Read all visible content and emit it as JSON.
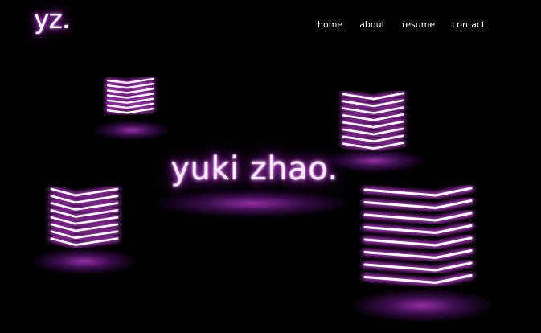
{
  "brand": {
    "logo": "yz."
  },
  "nav": {
    "items": [
      {
        "label": "home"
      },
      {
        "label": "about"
      },
      {
        "label": "resume"
      },
      {
        "label": "contact"
      }
    ]
  },
  "hero": {
    "title": "yuki zhao."
  },
  "colors": {
    "background": "#000000",
    "neon_core": "#ffffff",
    "neon_glow": "#c83ce0",
    "floor_glow": "#8a1fb0"
  },
  "decor": {
    "icons": [
      "neon-cube-icon",
      "neon-cube-icon",
      "neon-cube-icon",
      "neon-cube-icon"
    ]
  }
}
